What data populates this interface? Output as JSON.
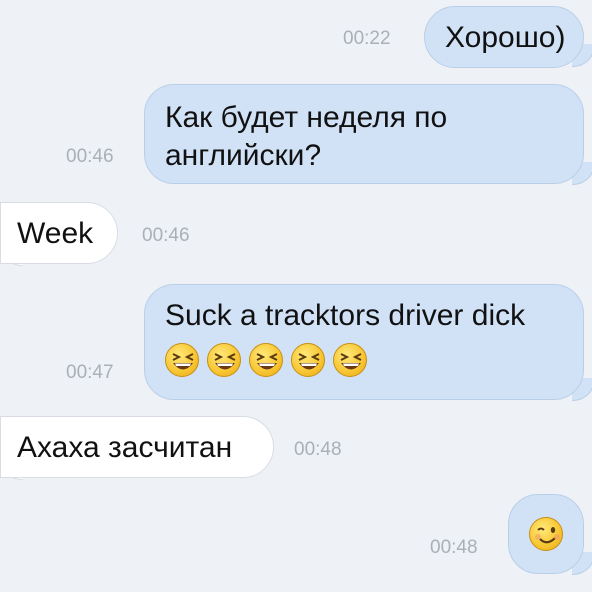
{
  "messages": [
    {
      "side": "out",
      "text": "Хорошо)",
      "time": "00:22"
    },
    {
      "side": "out",
      "text": "Как будет неделя по английски?",
      "time": "00:46"
    },
    {
      "side": "in",
      "text": "Week",
      "time": "00:46"
    },
    {
      "side": "out",
      "text": "Suck a tracktors driver dick",
      "time": "00:47",
      "emoji": [
        "laughing-face",
        "laughing-face",
        "laughing-face",
        "laughing-face",
        "laughing-face"
      ]
    },
    {
      "side": "in",
      "text": "Ахаха засчитан",
      "time": "00:48"
    },
    {
      "side": "out",
      "text": "",
      "time": "00:48",
      "emoji": [
        "winking-face"
      ]
    }
  ],
  "colors": {
    "background": "#eef1f6",
    "outgoing_bubble": "#d1e2f7",
    "incoming_bubble": "#ffffff",
    "timestamp": "#a9b0b9"
  }
}
